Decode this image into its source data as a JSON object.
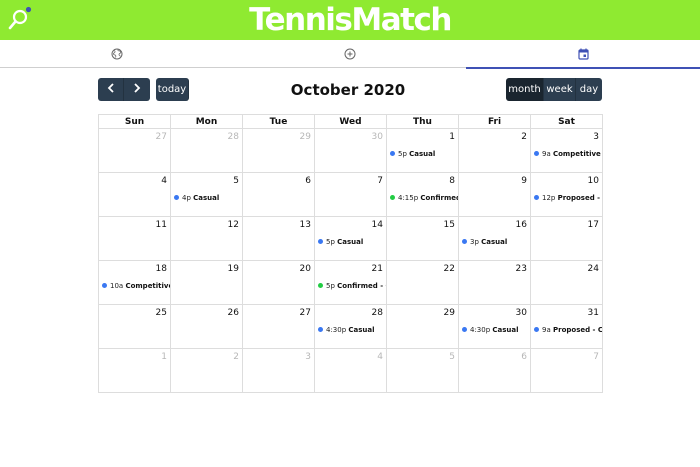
{
  "app": {
    "title": "TennisMatch",
    "logo_icon": "tennis-racket-logo-icon"
  },
  "colors": {
    "appbar": "#8fea31",
    "tab_indicator": "#3f51b5",
    "button": "#2c3e50",
    "button_active": "#1a252f",
    "event_blue": "#3a78f2",
    "event_green": "#22cc44"
  },
  "nav": {
    "tabs": [
      {
        "icon": "globe-icon",
        "active": false
      },
      {
        "icon": "add-circle-icon",
        "active": false
      },
      {
        "icon": "calendar-icon",
        "active": true
      }
    ]
  },
  "toolbar": {
    "prev_icon": "chevron-left-icon",
    "next_icon": "chevron-right-icon",
    "today_label": "today",
    "title": "October 2020",
    "views": [
      {
        "label": "month",
        "active": true
      },
      {
        "label": "week",
        "active": false
      },
      {
        "label": "day",
        "active": false
      }
    ]
  },
  "calendar": {
    "weekdays": [
      "Sun",
      "Mon",
      "Tue",
      "Wed",
      "Thu",
      "Fri",
      "Sat"
    ],
    "weeks": [
      [
        {
          "num": "27",
          "other": true
        },
        {
          "num": "28",
          "other": true
        },
        {
          "num": "29",
          "other": true
        },
        {
          "num": "30",
          "other": true
        },
        {
          "num": "1",
          "event": {
            "time": "5p",
            "title": "Casual",
            "color": "blue"
          }
        },
        {
          "num": "2"
        },
        {
          "num": "3",
          "event": {
            "time": "9a",
            "title": "Competitive",
            "color": "blue"
          }
        }
      ],
      [
        {
          "num": "4"
        },
        {
          "num": "5",
          "event": {
            "time": "4p",
            "title": "Casual",
            "color": "blue"
          }
        },
        {
          "num": "6"
        },
        {
          "num": "7"
        },
        {
          "num": "8",
          "event": {
            "time": "4:15p",
            "title": "Confirmed",
            "color": "green"
          }
        },
        {
          "num": "9"
        },
        {
          "num": "10",
          "event": {
            "time": "12p",
            "title": "Proposed - C",
            "color": "blue"
          }
        }
      ],
      [
        {
          "num": "11"
        },
        {
          "num": "12"
        },
        {
          "num": "13"
        },
        {
          "num": "14",
          "event": {
            "time": "5p",
            "title": "Casual",
            "color": "blue"
          }
        },
        {
          "num": "15"
        },
        {
          "num": "16",
          "event": {
            "time": "3p",
            "title": "Casual",
            "color": "blue"
          }
        },
        {
          "num": "17"
        }
      ],
      [
        {
          "num": "18",
          "event": {
            "time": "10a",
            "title": "Competitive",
            "color": "blue"
          }
        },
        {
          "num": "19"
        },
        {
          "num": "20"
        },
        {
          "num": "21",
          "event": {
            "time": "5p",
            "title": "Confirmed - C",
            "color": "green"
          }
        },
        {
          "num": "22"
        },
        {
          "num": "23"
        },
        {
          "num": "24"
        }
      ],
      [
        {
          "num": "25"
        },
        {
          "num": "26"
        },
        {
          "num": "27"
        },
        {
          "num": "28",
          "event": {
            "time": "4:30p",
            "title": "Casual",
            "color": "blue"
          }
        },
        {
          "num": "29"
        },
        {
          "num": "30",
          "event": {
            "time": "4:30p",
            "title": "Casual",
            "color": "blue"
          }
        },
        {
          "num": "31",
          "event": {
            "time": "9a",
            "title": "Proposed - Co",
            "color": "blue"
          }
        }
      ],
      [
        {
          "num": "1",
          "other": true
        },
        {
          "num": "2",
          "other": true
        },
        {
          "num": "3",
          "other": true
        },
        {
          "num": "4",
          "other": true
        },
        {
          "num": "5",
          "other": true
        },
        {
          "num": "6",
          "other": true
        },
        {
          "num": "7",
          "other": true
        }
      ]
    ]
  }
}
